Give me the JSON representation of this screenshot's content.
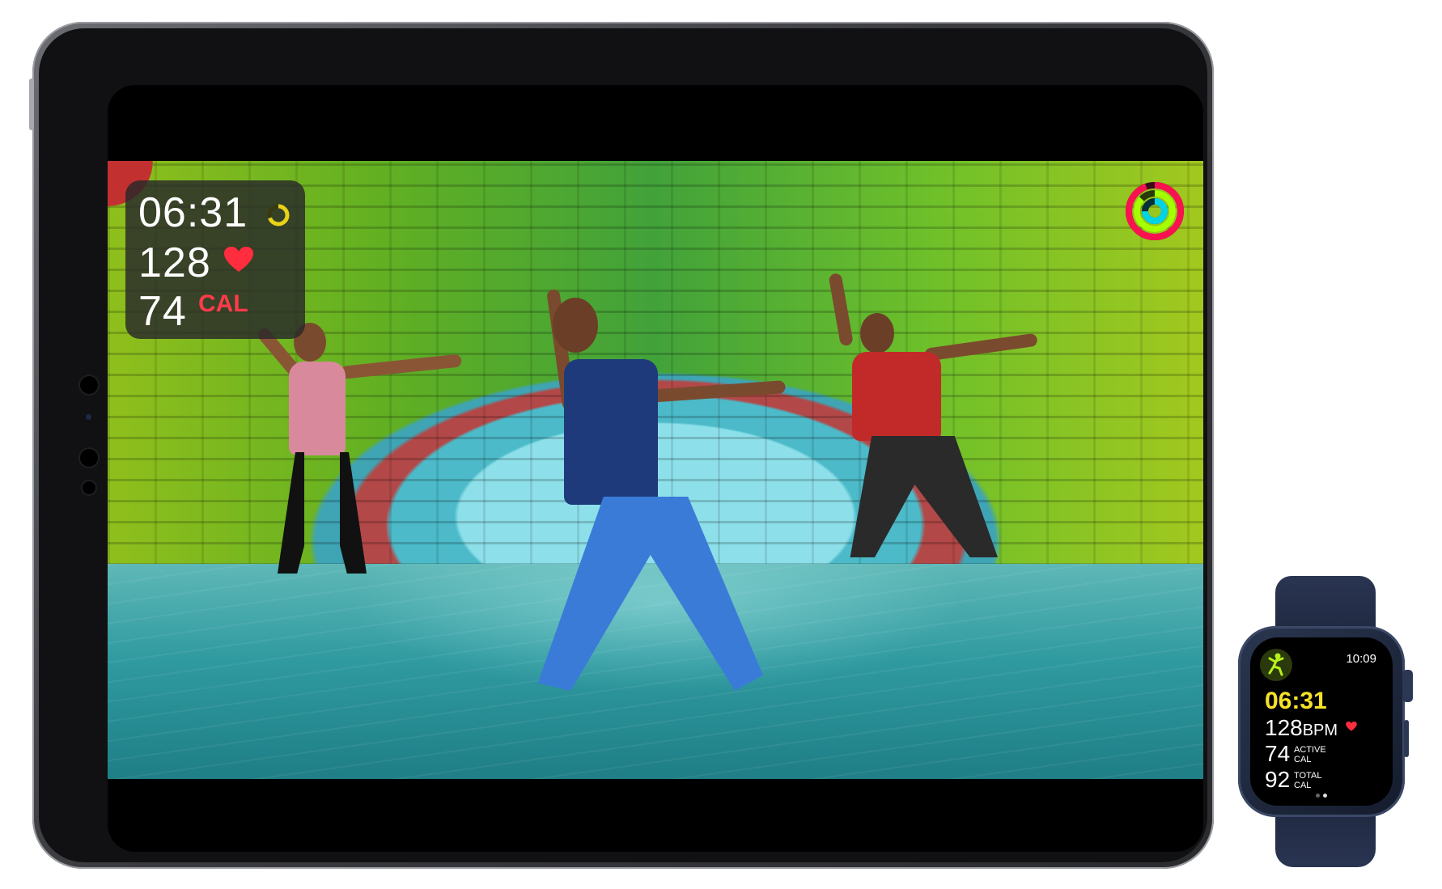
{
  "ipad_overlay": {
    "elapsed_time": "06:31",
    "heart_rate": "128",
    "calories": "74",
    "calories_unit": "CAL"
  },
  "watch": {
    "clock": "10:09",
    "elapsed_time": "06:31",
    "heart_rate": "128",
    "heart_rate_unit": "BPM",
    "active_calories": "74",
    "active_unit_line1": "ACTIVE",
    "active_unit_line2": "CAL",
    "total_calories": "92",
    "total_unit_line1": "TOTAL",
    "total_unit_line2": "CAL",
    "page_count": 2,
    "current_page": 1
  },
  "colors": {
    "move_ring": "#fa114f",
    "exercise_ring": "#a6ff00",
    "stand_ring": "#00d4e6",
    "calorie_red": "#ff3b4a",
    "workout_yellow": "#f5e12a"
  },
  "icons": [
    "heart-icon",
    "activity-rings-icon",
    "mini-ring-icon",
    "dance-workout-icon"
  ]
}
